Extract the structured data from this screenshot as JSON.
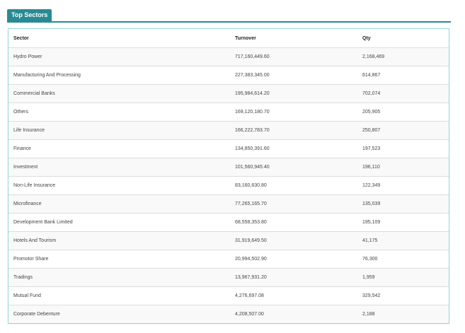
{
  "widget": {
    "title": "Top Sectors",
    "accent_color": "#2a8a93",
    "border_color": "#9ad6d3"
  },
  "table": {
    "headers": {
      "sector": "Sector",
      "turnover": "Turnover",
      "qty": "Qty"
    },
    "rows": [
      {
        "sector": "Hydro Power",
        "turnover": "717,160,449.60",
        "qty": "2,168,469"
      },
      {
        "sector": "Manufacturing And Processing",
        "turnover": "227,383,345.00",
        "qty": "614,867"
      },
      {
        "sector": "Commercial Banks",
        "turnover": "195,984,614.20",
        "qty": "702,074"
      },
      {
        "sector": "Others",
        "turnover": "169,120,180.70",
        "qty": "205,905"
      },
      {
        "sector": "Life Insurance",
        "turnover": "166,222,783.70",
        "qty": "250,807"
      },
      {
        "sector": "Finance",
        "turnover": "134,850,391.60",
        "qty": "197,523"
      },
      {
        "sector": "Investment",
        "turnover": "101,560,945.40",
        "qty": "196,110"
      },
      {
        "sector": "Non-Life Insurance",
        "turnover": "83,160,630.80",
        "qty": "122,349"
      },
      {
        "sector": "Microfinance",
        "turnover": "77,265,165.70",
        "qty": "135,039"
      },
      {
        "sector": "Development Bank Limited",
        "turnover": "68,558,353.80",
        "qty": "195,109"
      },
      {
        "sector": "Hotels And Tourism",
        "turnover": "31,919,649.50",
        "qty": "41,175"
      },
      {
        "sector": "Promotor Share",
        "turnover": "20,994,502.90",
        "qty": "76,300"
      },
      {
        "sector": "Tradings",
        "turnover": "13,967,931.20",
        "qty": "1,959"
      },
      {
        "sector": "Mutual Fund",
        "turnover": "4,276,697.08",
        "qty": "329,542"
      },
      {
        "sector": "Corporate Debenture",
        "turnover": "4,208,507.00",
        "qty": "2,188"
      }
    ]
  }
}
